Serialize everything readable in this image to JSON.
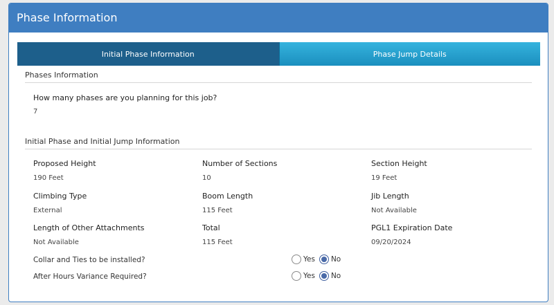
{
  "header": {
    "title": "Phase Information"
  },
  "tabs": [
    {
      "label": "Initial Phase Information",
      "active": true
    },
    {
      "label": "Phase Jump Details",
      "active": false
    }
  ],
  "phases_section": {
    "title": "Phases Information",
    "question": "How many phases are you planning for this job?",
    "answer": "7"
  },
  "initial_section": {
    "title": "Initial Phase and Initial Jump Information",
    "fields": [
      {
        "label": "Proposed Height",
        "value": "190 Feet"
      },
      {
        "label": "Number of Sections",
        "value": "10"
      },
      {
        "label": "Section Height",
        "value": "19 Feet"
      },
      {
        "label": "Climbing Type",
        "value": "External"
      },
      {
        "label": "Boom Length",
        "value": "115 Feet"
      },
      {
        "label": "Jib Length",
        "value": "Not Available"
      },
      {
        "label": "Length of Other Attachments",
        "value": "Not Available"
      },
      {
        "label": "Total",
        "value": "115 Feet"
      },
      {
        "label": "PGL1 Expiration Date",
        "value": "09/20/2024"
      }
    ],
    "radios": [
      {
        "label": "Collar and Ties to be installed?",
        "yes": "Yes",
        "no": "No",
        "selected": "No"
      },
      {
        "label": "After Hours Variance Required?",
        "yes": "Yes",
        "no": "No",
        "selected": "No"
      }
    ]
  },
  "colors": {
    "header": "#3f7ec1",
    "tab_active": "#1d5f8b",
    "tab_inactive": "#2aa3d2"
  }
}
